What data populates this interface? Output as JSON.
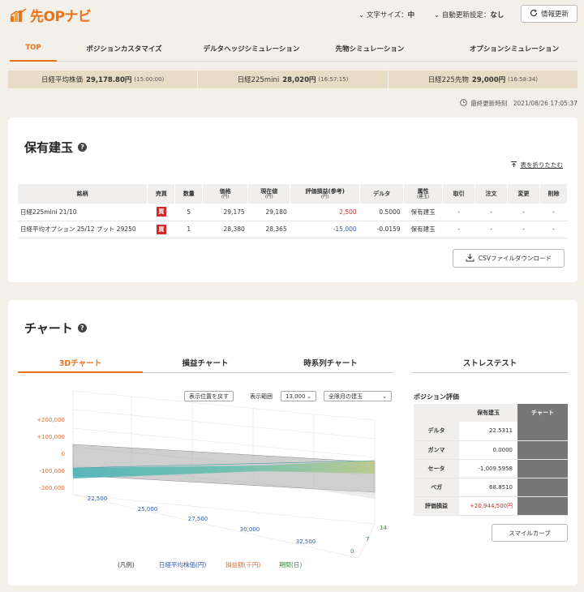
{
  "app": {
    "logo": "先OPナビ"
  },
  "header": {
    "font_size_label": "文字サイズ：",
    "font_size_value": "中",
    "auto_update_label": "自動更新設定：",
    "auto_update_value": "なし",
    "refresh_label": "情報更新"
  },
  "nav": [
    "TOP",
    "ポジションカスタマイズ",
    "デルタヘッジシミュレーション",
    "先物シミュレーション",
    "オプションシミュレーション"
  ],
  "ticker": [
    {
      "name": "日経平均株価",
      "value": "29,178.80円",
      "time": "(15:00:00)"
    },
    {
      "name": "日経225mini",
      "value": "28,020円",
      "time": "(16:57:15)"
    },
    {
      "name": "日経225先物",
      "value": "29,000円",
      "time": "(16:58:34)"
    }
  ],
  "last_updated": "最終更新時刻　2021/08/26 17:05:37",
  "positions": {
    "title": "保有建玉",
    "collapse_label": "表を折りたたむ",
    "headers": [
      "銘柄",
      "売買",
      "数量",
      "価格",
      "現在値",
      "評価損益(参考)",
      "デルタ",
      "属性",
      "取引",
      "注文",
      "変更",
      "削除"
    ],
    "header_units": [
      "",
      "",
      "",
      "(円)",
      "(円)",
      "(円)",
      "",
      "(建玉)",
      "",
      "",
      "",
      ""
    ],
    "rows": [
      {
        "name": "日経225mini 21/10",
        "side": "買",
        "qty": "5",
        "price": "29,175",
        "current": "29,180",
        "pl": "2,500",
        "delta": "0.5000",
        "attr": "保有建玉",
        "trade": "-",
        "order": "-",
        "change": "-",
        "del": "-"
      },
      {
        "name": "日経平均オプション 25/12 プット 29250",
        "side": "買",
        "qty": "1",
        "price": "28,380",
        "current": "28,365",
        "pl": "-15,000",
        "delta": "-0.0159",
        "attr": "保有建玉",
        "trade": "-",
        "order": "-",
        "change": "-",
        "del": "-"
      }
    ],
    "csv_label": "CSVファイルダウンロード"
  },
  "chart": {
    "title": "チャート",
    "tabs": [
      "3Dチャート",
      "損益チャート",
      "時系列チャート"
    ],
    "stress_tab": "ストレステスト",
    "reset_view": "表示位置を戻す",
    "range_label": "表示範囲",
    "range_value": "13,000",
    "month_value": "全限月の建玉",
    "z_ticks": [
      "+200,000",
      "+100,000",
      "0",
      "-100,000",
      "-200,000"
    ],
    "x_ticks": [
      "22,500",
      "25,000",
      "27,500",
      "30,000",
      "32,500"
    ],
    "y_ticks": [
      "14",
      "7",
      "0"
    ],
    "legend_label": "(凡例)",
    "legend_x": "日経平均株価(円)",
    "legend_z": "損益額(千円)",
    "legend_y": "期間(日)",
    "colors": {
      "x": "#2f5ea8",
      "z": "#d9703a",
      "y": "#3a8a3a"
    }
  },
  "evaluation": {
    "title": "ポジション評価",
    "col_holding": "保有建玉",
    "col_chart": "チャート",
    "rows": [
      {
        "k": "デルタ",
        "v": "22.5311"
      },
      {
        "k": "ガンマ",
        "v": "0.0000"
      },
      {
        "k": "セータ",
        "v": "-1,009.5958"
      },
      {
        "k": "ベガ",
        "v": "68.8510"
      },
      {
        "k": "評価損益",
        "v": "+20,944,500円"
      }
    ],
    "smile_label": "スマイルカーブ"
  }
}
